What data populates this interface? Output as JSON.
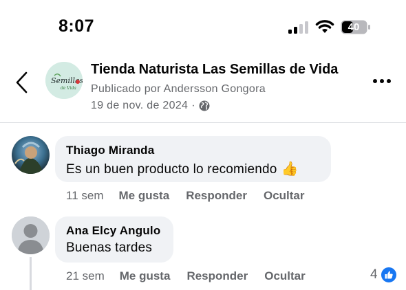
{
  "status_bar": {
    "time": "8:07",
    "battery_level": "40",
    "signal_icon": "cellular-signal-icon",
    "wifi_icon": "wifi-icon",
    "battery_icon": "battery-icon"
  },
  "post_header": {
    "page_name": "Tienda Naturista Las Semillas de Vida",
    "published_by": "Publicado por Andersson Gongora",
    "date": "19 de nov. de 2024",
    "separator": "·",
    "audience_icon": "globe-icon",
    "back_icon": "chevron-left-icon",
    "more_icon": "more-horizontal-icon",
    "avatar_logo_text": "Semillas de Vida"
  },
  "comments": [
    {
      "author": "Thiago Miranda",
      "text": "Es un buen producto lo recomiendo",
      "emoji": "👍",
      "age": "11 sem",
      "actions": [
        "Me gusta",
        "Responder",
        "Ocultar"
      ]
    },
    {
      "author": "Ana Elcy Angulo",
      "text": "Buenas tardes",
      "age": "21 sem",
      "actions": [
        "Me gusta",
        "Responder",
        "Ocultar"
      ],
      "reaction_count": "4",
      "reaction_icon": "like-reaction-icon"
    }
  ],
  "colors": {
    "text_primary": "#050505",
    "text_secondary": "#65676b",
    "bubble_bg": "#f0f2f5",
    "like_blue": "#1877f2",
    "divider": "#dadde1"
  }
}
